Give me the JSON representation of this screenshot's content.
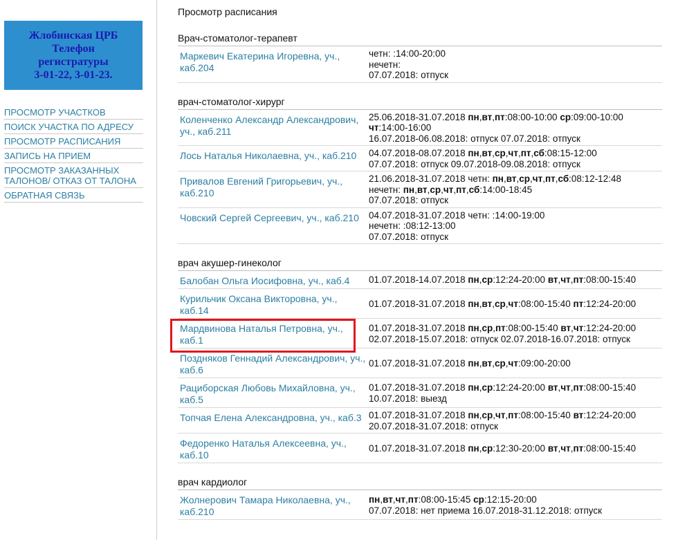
{
  "banner": {
    "lines": [
      "Жлобинская ЦРБ",
      "Телефон",
      "регистратуры",
      "3-01-22, 3-01-23."
    ]
  },
  "nav": [
    "Просмотр участков",
    "Поиск участка по адресу",
    "Просмотр расписания",
    "Запись на прием",
    "Просмотр заказанных талонов/ отказ от талона",
    "Обратная связь"
  ],
  "page_title": "Просмотр расписания",
  "sections": [
    {
      "title": "Врач-стоматолог-терапевт",
      "doctors": [
        {
          "name": "Маркевич Екатерина Игоревна, уч., каб.204",
          "schedule": [
            "четн: :14:00-20:00",
            "нечетн:",
            "07.07.2018: отпуск"
          ]
        }
      ]
    },
    {
      "title": "врач-стоматолог-хирург",
      "doctors": [
        {
          "name": "Коленченко Александр Александрович, уч., каб.211",
          "schedule": [
            "25.06.2018-31.07.2018 **пн**,**вт**,**пт**:08:00-10:00 **ср**:09:00-10:00 **чт**:14:00-16:00",
            "16.07.2018-06.08.2018: отпуск 07.07.2018: отпуск"
          ]
        },
        {
          "name": "Лось Наталья Николаевна, уч., каб.210",
          "schedule": [
            "04.07.2018-08.07.2018 **пн**,**вт**,**ср**,**чт**,**пт**,**сб**:08:15-12:00",
            "07.07.2018: отпуск 09.07.2018-09.08.2018: отпуск"
          ]
        },
        {
          "name": "Привалов Евгений Григорьевич, уч., каб.210",
          "schedule": [
            "21.06.2018-31.07.2018 четн: **пн**,**вт**,**ср**,**чт**,**пт**,**сб**:08:12-12:48",
            "нечетн: **пн**,**вт**,**ср**,**чт**,**пт**,**сб**:14:00-18:45",
            "07.07.2018: отпуск"
          ]
        },
        {
          "name": "Човский Сергей Сергеевич, уч., каб.210",
          "schedule": [
            "04.07.2018-31.07.2018 четн: :14:00-19:00",
            "нечетн: :08:12-13:00",
            "07.07.2018: отпуск"
          ]
        }
      ]
    },
    {
      "title": "врач акушер-гинеколог",
      "doctors": [
        {
          "name": "Балобан Ольга Иосифовна, уч., каб.4",
          "schedule": [
            "01.07.2018-14.07.2018 **пн**,**ср**:12:24-20:00 **вт**,**чт**,**пт**:08:00-15:40"
          ]
        },
        {
          "name": "Курильчик Оксана Викторовна, уч., каб.14",
          "schedule": [
            "01.07.2018-31.07.2018 **пн**,**вт**,**ср**,**чт**:08:00-15:40 **пт**:12:24-20:00"
          ]
        },
        {
          "name": "Мардвинова Наталья Петровна, уч., каб.1",
          "highlight": true,
          "schedule": [
            "01.07.2018-31.07.2018 **пн**,**ср**,**пт**:08:00-15:40 **вт**,**чт**:12:24-20:00",
            "02.07.2018-15.07.2018: отпуск 02.07.2018-16.07.2018: отпуск"
          ]
        },
        {
          "name": "Поздняков Геннадий Александрович, уч., каб.6",
          "schedule": [
            "01.07.2018-31.07.2018 **пн**,**вт**,**ср**,**чт**:09:00-20:00"
          ]
        },
        {
          "name": "Рацибoрская Любовь Михайловна, уч., каб.5",
          "schedule": [
            "01.07.2018-31.07.2018 **пн**,**ср**:12:24-20:00 **вт**,**чт**,**пт**:08:00-15:40",
            "10.07.2018: выезд"
          ]
        },
        {
          "name": "Топчая Елена Александровна, уч., каб.3",
          "schedule": [
            "01.07.2018-31.07.2018 **пн**,**ср**,**чт**,**пт**:08:00-15:40 **вт**:12:24-20:00",
            "20.07.2018-31.07.2018: отпуск"
          ]
        },
        {
          "name": "Федоренко Наталья Алексеевна, уч., каб.10",
          "schedule": [
            "01.07.2018-31.07.2018 **пн**,**ср**:12:30-20:00 **вт**,**чт**,**пт**:08:00-15:40"
          ]
        }
      ]
    },
    {
      "title": "врач кардиолог",
      "doctors": [
        {
          "name": "Жолнерович Тамара Николаевна, уч., каб.210",
          "schedule": [
            "**пн**,**вт**,**чт**,**пт**:08:00-15:45 **ср**:12:15-20:00",
            "07.07.2018: нет приема 16.07.2018-31.12.2018: отпуск"
          ]
        }
      ]
    }
  ]
}
